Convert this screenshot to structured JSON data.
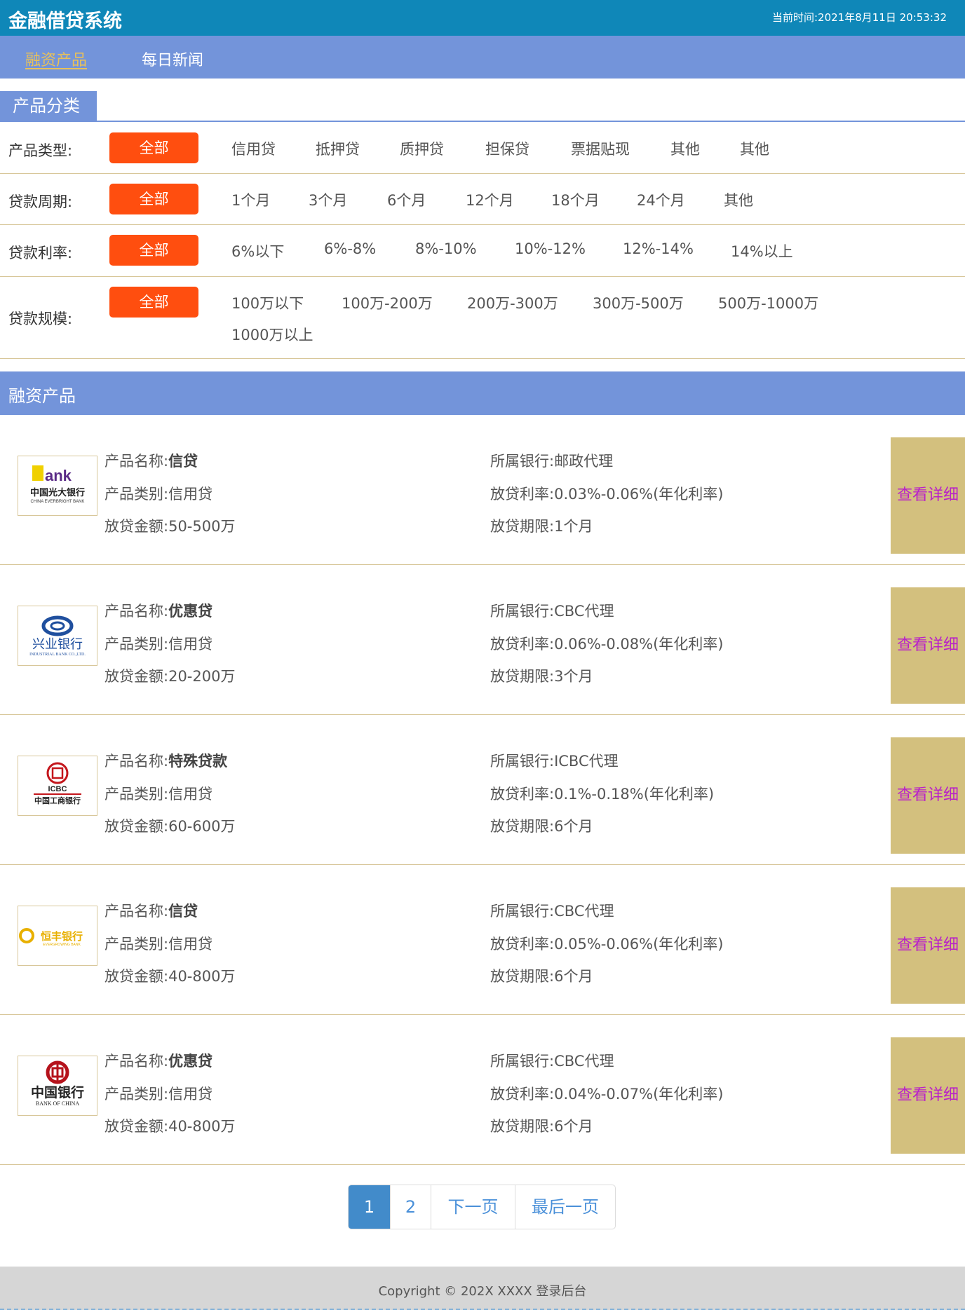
{
  "header": {
    "app_title": "金融借贷系统",
    "clock_label": "当前时间:",
    "clock_value": "2021年8月11日 20:53:32"
  },
  "nav": {
    "items": [
      {
        "label": "融资产品",
        "active": true
      },
      {
        "label": "每日新闻",
        "active": false
      }
    ]
  },
  "category_section": {
    "title": "产品分类"
  },
  "filters": [
    {
      "label": "产品类型:",
      "all": "全部",
      "options": [
        "信用贷",
        "抵押贷",
        "质押贷",
        "担保贷",
        "票据贴现",
        "其他",
        "其他"
      ]
    },
    {
      "label": "贷款周期:",
      "all": "全部",
      "options": [
        "1个月",
        "3个月",
        "6个月",
        "12个月",
        "18个月",
        "24个月",
        "其他"
      ]
    },
    {
      "label": "贷款利率:",
      "all": "全部",
      "options": [
        "6%以下",
        "6%-8%",
        "8%-10%",
        "10%-12%",
        "12%-14%",
        "14%以上"
      ]
    },
    {
      "label": "贷款规模:",
      "all": "全部",
      "options": [
        "100万以下",
        "100万-200万",
        "200万-300万",
        "300万-500万",
        "500万-1000万",
        "1000万以上"
      ]
    }
  ],
  "products_section": {
    "title": "融资产品"
  },
  "field_labels": {
    "name": "产品名称:",
    "category": "产品类别:",
    "amount": "放贷金额:",
    "bank": "所属银行:",
    "rate": "放贷利率:",
    "term": "放贷期限:"
  },
  "detail_label": "查看详细",
  "products": [
    {
      "logo": "everbright-bank-logo",
      "logo_text_a": "Bank",
      "logo_text_b": "中国光大银行",
      "logo_text_c": "CHINA EVERBRIGHT BANK",
      "name": "信贷",
      "category": "信用贷",
      "amount": "50-500万",
      "bank": "邮政代理",
      "rate": "0.03%-0.06%(年化利率)",
      "term": "1个月"
    },
    {
      "logo": "industrial-bank-logo",
      "logo_text_a": "",
      "logo_text_b": "兴业银行",
      "logo_text_c": "INDUSTRIAL BANK CO.,LTD.",
      "name": "优惠贷",
      "category": "信用贷",
      "amount": "20-200万",
      "bank": "CBC代理",
      "rate": "0.06%-0.08%(年化利率)",
      "term": "3个月"
    },
    {
      "logo": "icbc-logo",
      "logo_text_a": "ICBC",
      "logo_text_b": "中国工商银行",
      "logo_text_c": "",
      "name": "特殊贷款",
      "category": "信用贷",
      "amount": "60-600万",
      "bank": "ICBC代理",
      "rate": "0.1%-0.18%(年化利率)",
      "term": "6个月"
    },
    {
      "logo": "evergrowing-bank-logo",
      "logo_text_a": "",
      "logo_text_b": "恒丰银行",
      "logo_text_c": "EVERGROWING BANK",
      "name": "信贷",
      "category": "信用贷",
      "amount": "40-800万",
      "bank": "CBC代理",
      "rate": "0.05%-0.06%(年化利率)",
      "term": "6个月"
    },
    {
      "logo": "bank-of-china-logo",
      "logo_text_a": "",
      "logo_text_b": "中国银行",
      "logo_text_c": "BANK OF CHINA",
      "name": "优惠贷",
      "category": "信用贷",
      "amount": "40-800万",
      "bank": "CBC代理",
      "rate": "0.04%-0.07%(年化利率)",
      "term": "6个月"
    }
  ],
  "pagination": {
    "pages": [
      "1",
      "2"
    ],
    "current": "1",
    "next_label": "下一页",
    "last_label": "最后一页"
  },
  "footer": {
    "copyright": "Copyright © 202X XXXX 登录后台"
  },
  "colors": {
    "header": "#0f87b8",
    "nav": "#7394da",
    "accent_orange": "#ff4e0f",
    "detail_button": "#d3c07e",
    "detail_text": "#b820c8",
    "nav_active": "#e8c15a"
  }
}
